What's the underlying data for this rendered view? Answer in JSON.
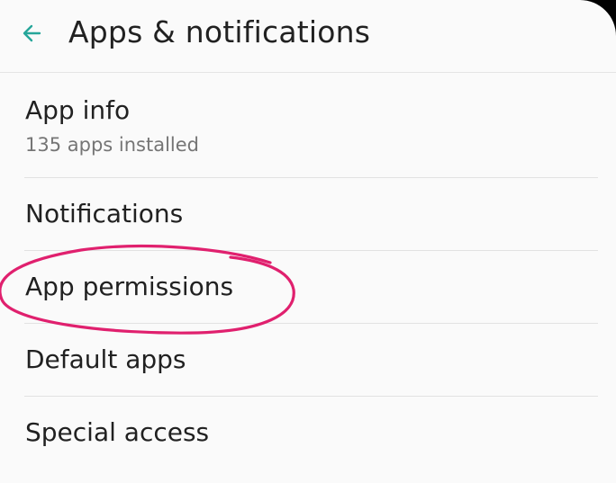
{
  "header": {
    "back_icon": "arrow-left-icon",
    "title": "Apps & notifications"
  },
  "list": {
    "items": [
      {
        "label": "App info",
        "subtitle": "135 apps installed"
      },
      {
        "label": "Notifications"
      },
      {
        "label": "App permissions"
      },
      {
        "label": "Default apps"
      },
      {
        "label": "Special access"
      }
    ]
  },
  "colors": {
    "accent": "#26a69a",
    "background": "#fafafa",
    "primary_text": "#212121",
    "secondary_text": "#757575",
    "annotation_circle": "#e0206e"
  }
}
